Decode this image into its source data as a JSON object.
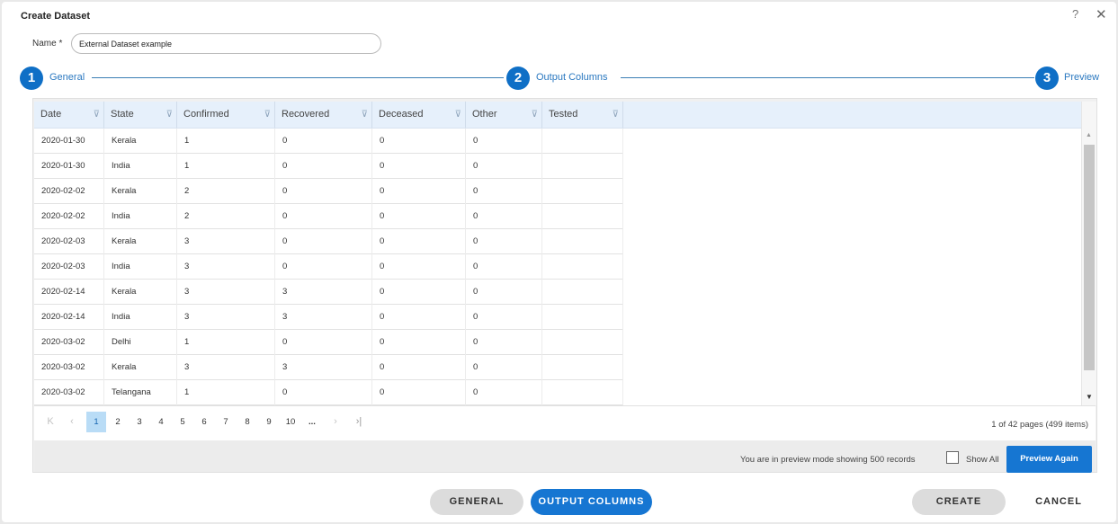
{
  "dialog": {
    "title": "Create Dataset",
    "help": "?",
    "close": "✕"
  },
  "name_field": {
    "label": "Name *",
    "value": "External Dataset example"
  },
  "steps": [
    {
      "number": "1",
      "label": "General"
    },
    {
      "number": "2",
      "label": "Output Columns"
    },
    {
      "number": "3",
      "label": "Preview"
    }
  ],
  "grid": {
    "filter_glyph": "⊽",
    "columns": [
      "Date",
      "State",
      "Confirmed",
      "Recovered",
      "Deceased",
      "Other",
      "Tested"
    ],
    "rows": [
      [
        "2020-01-30",
        "Kerala",
        "1",
        "0",
        "0",
        "0",
        ""
      ],
      [
        "2020-01-30",
        "India",
        "1",
        "0",
        "0",
        "0",
        ""
      ],
      [
        "2020-02-02",
        "Kerala",
        "2",
        "0",
        "0",
        "0",
        ""
      ],
      [
        "2020-02-02",
        "India",
        "2",
        "0",
        "0",
        "0",
        ""
      ],
      [
        "2020-02-03",
        "Kerala",
        "3",
        "0",
        "0",
        "0",
        ""
      ],
      [
        "2020-02-03",
        "India",
        "3",
        "0",
        "0",
        "0",
        ""
      ],
      [
        "2020-02-14",
        "Kerala",
        "3",
        "3",
        "0",
        "0",
        ""
      ],
      [
        "2020-02-14",
        "India",
        "3",
        "3",
        "0",
        "0",
        ""
      ],
      [
        "2020-03-02",
        "Delhi",
        "1",
        "0",
        "0",
        "0",
        ""
      ],
      [
        "2020-03-02",
        "Kerala",
        "3",
        "3",
        "0",
        "0",
        ""
      ],
      [
        "2020-03-02",
        "Telangana",
        "1",
        "0",
        "0",
        "0",
        ""
      ]
    ]
  },
  "pager": {
    "first": "K",
    "prev": "‹",
    "pages": [
      "1",
      "2",
      "3",
      "4",
      "5",
      "6",
      "7",
      "8",
      "9",
      "10"
    ],
    "ellipsis": "...",
    "next": "›",
    "last": "›|",
    "current_page": "1",
    "info": "1 of 42 pages (499 items)"
  },
  "preview_bar": {
    "text": "You are in preview mode showing 500 records",
    "show_all_label": "Show All",
    "preview_again": "Preview Again"
  },
  "footer": {
    "general": "GENERAL",
    "output_columns": "OUTPUT COLUMNS",
    "create": "CREATE",
    "cancel": "CANCEL"
  },
  "colors": {
    "accent": "#1676d2",
    "step_circle": "#0f6fc6",
    "header_bg": "#e6f0fb"
  }
}
